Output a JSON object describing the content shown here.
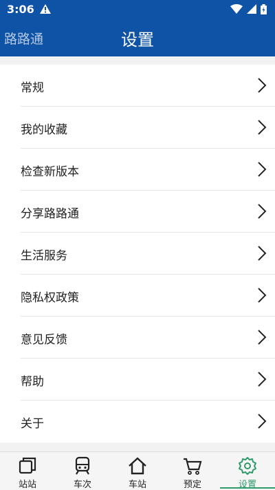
{
  "status": {
    "time": "3:06"
  },
  "header": {
    "app_name": "路路通",
    "title": "设置"
  },
  "settings": {
    "items": [
      {
        "label": "常规"
      },
      {
        "label": "我的收藏"
      },
      {
        "label": "检查新版本"
      },
      {
        "label": "分享路路通"
      },
      {
        "label": "生活服务"
      },
      {
        "label": "隐私权政策"
      },
      {
        "label": "意见反馈"
      },
      {
        "label": "帮助"
      },
      {
        "label": "关于"
      }
    ]
  },
  "tabbar": {
    "tabs": [
      {
        "label": "站站",
        "icon": "cards-icon"
      },
      {
        "label": "车次",
        "icon": "train-icon"
      },
      {
        "label": "车站",
        "icon": "home-icon"
      },
      {
        "label": "预定",
        "icon": "cart-icon"
      },
      {
        "label": "设置",
        "icon": "gear-icon",
        "active": true
      }
    ]
  },
  "colors": {
    "primary": "#0f53a6",
    "active_tab": "#2e9a6b"
  }
}
